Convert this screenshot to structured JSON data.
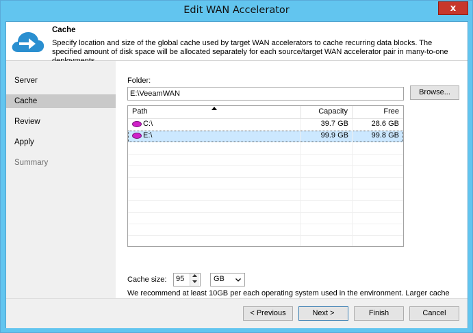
{
  "window": {
    "title": "Edit WAN Accelerator",
    "close_glyph": "x"
  },
  "header": {
    "icon": "cloud-arrow-icon",
    "title": "Cache",
    "description": "Specify location and size of the global cache used by target WAN accelerators to cache recurring data blocks. The specified amount of disk space will be allocated separately for each source/target WAN accelerator pair in many-to-one deployments."
  },
  "steps": [
    {
      "label": "Server",
      "state": "normal"
    },
    {
      "label": "Cache",
      "state": "active"
    },
    {
      "label": "Review",
      "state": "normal"
    },
    {
      "label": "Apply",
      "state": "normal"
    },
    {
      "label": "Summary",
      "state": "disabled"
    }
  ],
  "folder": {
    "label": "Folder:",
    "value": "E:\\VeeamWAN",
    "browse_label": "Browse..."
  },
  "drives": {
    "columns": [
      "Path",
      "Capacity",
      "Free"
    ],
    "sort_column": "Path",
    "rows": [
      {
        "path": "C:\\",
        "capacity": "39.7 GB",
        "free": "28.6 GB",
        "selected": false
      },
      {
        "path": "E:\\",
        "capacity": "99.9 GB",
        "free": "99.8 GB",
        "selected": true
      }
    ]
  },
  "cache": {
    "label": "Cache size:",
    "value": "95",
    "unit": "GB",
    "hint": "We recommend at least 10GB per each operating system used in the environment. Larger cache improves data reduction ratio, but requires faster storage."
  },
  "footer": {
    "previous_label": "< Previous",
    "next_label": "Next >",
    "finish_label": "Finish",
    "cancel_label": "Cancel"
  },
  "colors": {
    "title_bar": "#62c5ef",
    "close_button": "#c7372b",
    "icon_blue": "#2a8fd0",
    "disk_magenta": "#d021c9",
    "selection": "#cce8ff"
  }
}
